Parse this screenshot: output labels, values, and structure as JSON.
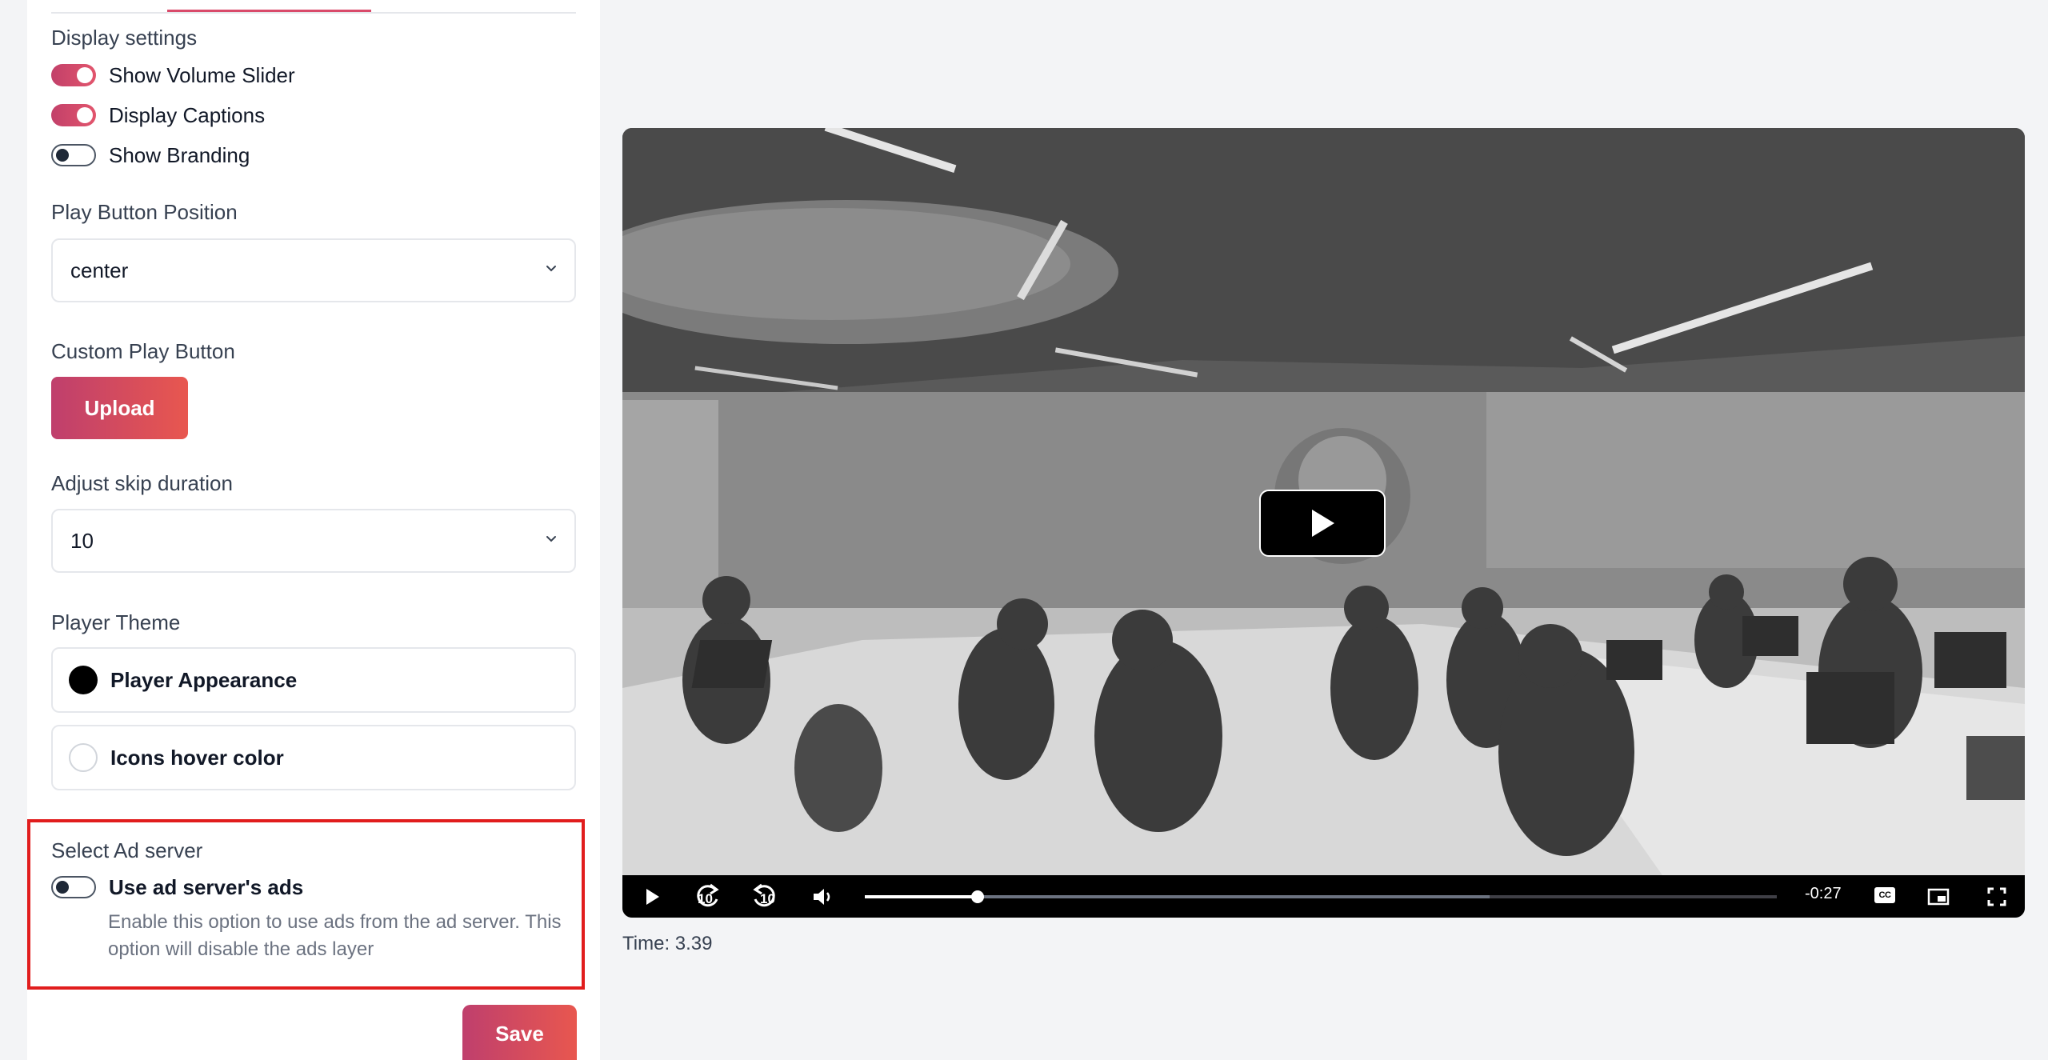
{
  "display_settings": {
    "heading": "Display settings",
    "toggles": [
      {
        "label": "Show Volume Slider",
        "on": true
      },
      {
        "label": "Display Captions",
        "on": true
      },
      {
        "label": "Show Branding",
        "on": false
      }
    ]
  },
  "play_button_position": {
    "label": "Play Button Position",
    "value": "center"
  },
  "custom_play_button": {
    "label": "Custom Play Button",
    "upload_label": "Upload"
  },
  "skip_duration": {
    "label": "Adjust skip duration",
    "value": "10"
  },
  "player_theme": {
    "label": "Player Theme",
    "rows": [
      {
        "label": "Player Appearance",
        "color": "#000000"
      },
      {
        "label": "Icons hover color",
        "color": "#ffffff"
      }
    ]
  },
  "ad_server": {
    "heading": "Select Ad server",
    "toggle_label": "Use ad server's ads",
    "toggle_on": false,
    "description": "Enable this option to use ads from the ad server. This option will disable the ads layer"
  },
  "save_label": "Save",
  "player": {
    "time_remaining": "-0:27",
    "skip_back_seconds": "10",
    "skip_forward_seconds": "10",
    "captions_label": "CC",
    "progress_fraction": 0.124,
    "buffered_fraction": 0.685
  },
  "time_readout": "Time: 3.39",
  "colors": {
    "accent_start": "#bf3f6d",
    "accent_end": "#e8574f",
    "highlight_border": "#e11d1d"
  }
}
